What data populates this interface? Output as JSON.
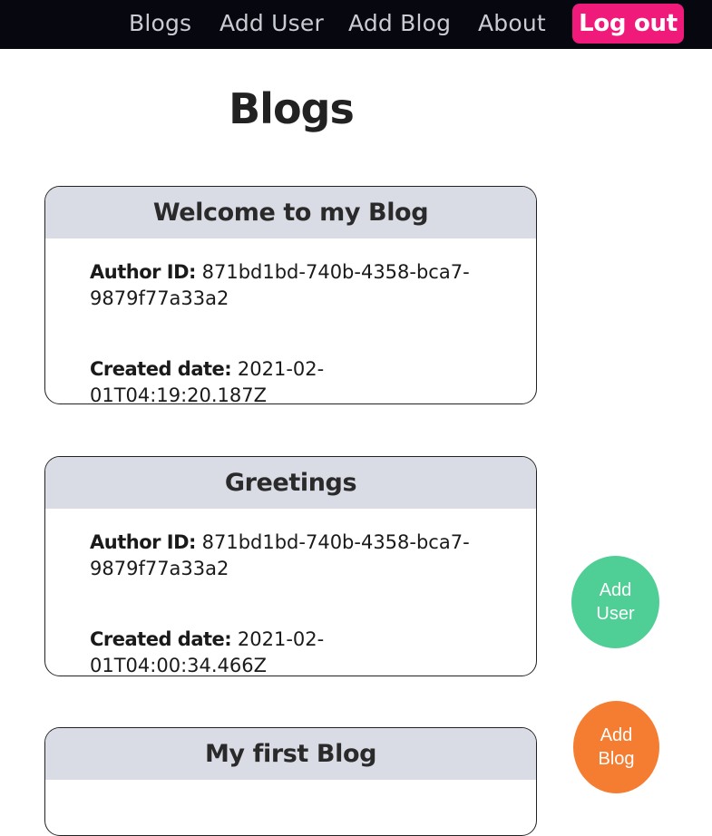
{
  "nav": {
    "links": [
      "Blogs",
      "Add User",
      "Add Blog",
      "About"
    ],
    "logout_label": "Log out"
  },
  "page": {
    "title": "Blogs"
  },
  "blogs": [
    {
      "title": "Welcome to my Blog",
      "author_label": "Author ID:",
      "author_id": "871bd1bd-740b-4358-bca7-9879f77a33a2",
      "created_label": "Created date:",
      "created_date": "2021-02-01T04:19:20.187Z"
    },
    {
      "title": "Greetings",
      "author_label": "Author ID:",
      "author_id": "871bd1bd-740b-4358-bca7-9879f77a33a2",
      "created_label": "Created date:",
      "created_date": "2021-02-01T04:00:34.466Z"
    },
    {
      "title": "My first Blog"
    }
  ],
  "fab": {
    "add_user_label": "Add User",
    "add_blog_label": "Add Blog"
  },
  "colors": {
    "nav_bg": "#07070f",
    "logout_bg": "#ef1a7a",
    "card_header_bg": "#d9dbe5",
    "add_user_bg": "#4fce95",
    "add_blog_bg": "#f57d31"
  }
}
